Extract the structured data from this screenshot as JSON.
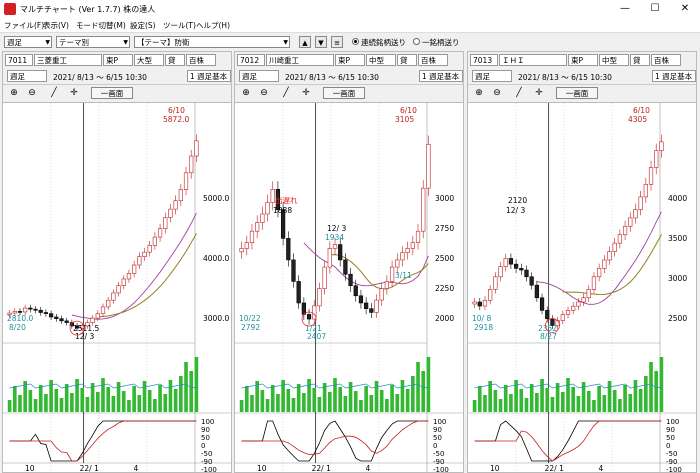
{
  "window": {
    "title": "マルチチャート (Ver 1.7.7)  株の達人",
    "minimize": "—",
    "maximize": "☐",
    "close": "✕"
  },
  "menu": [
    "ファイル(F)",
    "表示(V)",
    "モード切替(M)",
    "設定(S)",
    "ツール(T)",
    "ヘルプ(H)"
  ],
  "toolbar": {
    "period": "週足",
    "group": "テーマ別",
    "theme": "【テーマ】防衛",
    "up_icon": "▲",
    "down_icon": "▼",
    "list_icon": "≡",
    "radio1": "連続銘柄送り",
    "radio2": "一銘柄送り"
  },
  "panels": [
    {
      "code": "7011",
      "name": "三菱重工",
      "market": "東P",
      "size": "大型",
      "lending": "貸",
      "unit": "百株",
      "period": "週足",
      "date_range": "2021/ 8/13 ～  6/15 10:30",
      "basis": "1 週足基本",
      "one_screen": "一画面",
      "chart_data": {
        "type": "candlestick",
        "price_ticks": [
          "5000.0",
          "4000.0",
          "3000.0"
        ],
        "annotations": [
          {
            "text": "6/10",
            "color": "#c02020"
          },
          {
            "text": "5872.0",
            "color": "#c02020"
          },
          {
            "text": "2810.0",
            "color": "#2090a0"
          },
          {
            "text": "8/20",
            "color": "#2090a0"
          },
          {
            "text": "2511.5",
            "color": "#000"
          },
          {
            "text": "12/ 3",
            "color": "#000"
          }
        ],
        "osc_ticks": [
          "100",
          "90",
          "50",
          "0",
          "-50",
          "-90",
          "-100"
        ],
        "x_ticks": [
          "10",
          "22/ 1",
          "4"
        ],
        "close": [
          2790,
          2820,
          2810,
          2880,
          2860,
          2840,
          2800,
          2780,
          2720,
          2690,
          2650,
          2620,
          2560,
          2520,
          2560,
          2620,
          2700,
          2780,
          2900,
          3020,
          3150,
          3280,
          3400,
          3500,
          3650,
          3800,
          3880,
          4000,
          4150,
          4300,
          4500,
          4650,
          4800,
          5000,
          5300,
          5600,
          5872
        ]
      }
    },
    {
      "code": "7012",
      "name": "川崎重工",
      "market": "東P",
      "size": "中型",
      "lending": "貸",
      "unit": "百株",
      "period": "週足",
      "date_range": "2021/ 8/13 ～  6/15 10:30",
      "basis": "1 週足基本",
      "one_screen": "一画面",
      "chart_data": {
        "type": "candlestick",
        "price_ticks": [
          "3000",
          "2750",
          "2500",
          "2250",
          "2000"
        ],
        "annotations": [
          {
            "text": "6/10",
            "color": "#c02020"
          },
          {
            "text": "3105",
            "color": "#c02020"
          },
          {
            "text": "10/22",
            "color": "#2090a0"
          },
          {
            "text": "2792",
            "color": "#2090a0"
          },
          {
            "text": "1/21",
            "color": "#2090a0"
          },
          {
            "text": "2407",
            "color": "#2090a0"
          },
          {
            "text": "出遅れ",
            "color": "#e02020"
          },
          {
            "text": "1888",
            "color": "#000"
          },
          {
            "text": "12/ 3",
            "color": "#000"
          },
          {
            "text": "1934",
            "color": "#2090a0"
          },
          {
            "text": "3/11",
            "color": "#2090a0"
          }
        ],
        "osc_ticks": [
          "100",
          "90",
          "50",
          "0",
          "-50",
          "-90",
          "-100"
        ],
        "x_ticks": [
          "10",
          "22/ 1",
          "4"
        ],
        "close": [
          2380,
          2420,
          2500,
          2560,
          2620,
          2700,
          2792,
          2650,
          2450,
          2300,
          2150,
          2000,
          1920,
          1888,
          1980,
          2100,
          2250,
          2380,
          2407,
          2300,
          2200,
          2120,
          2050,
          2000,
          1960,
          1934,
          2020,
          2100,
          2150,
          2250,
          2300,
          2350,
          2380,
          2420,
          2500,
          2800,
          3105
        ]
      }
    },
    {
      "code": "7013",
      "name": "ＩＨＩ",
      "market": "東P",
      "size": "中型",
      "lending": "貸",
      "unit": "百株",
      "period": "週足",
      "date_range": "2021/ 8/13 ～  6/15 10:30",
      "basis": "1 週足基本",
      "one_screen": "一画面",
      "chart_data": {
        "type": "candlestick",
        "price_ticks": [
          "4000",
          "3500",
          "3000",
          "2500"
        ],
        "annotations": [
          {
            "text": "6/10",
            "color": "#c02020"
          },
          {
            "text": "4305",
            "color": "#c02020"
          },
          {
            "text": "10/ 8",
            "color": "#2090a0"
          },
          {
            "text": "2918",
            "color": "#2090a0"
          },
          {
            "text": "2352",
            "color": "#2090a0"
          },
          {
            "text": "8/27",
            "color": "#2090a0"
          },
          {
            "text": "2120",
            "color": "#000"
          },
          {
            "text": "12/ 3",
            "color": "#000"
          }
        ],
        "osc_ticks": [
          "100",
          "90",
          "50",
          "0",
          "-50",
          "-90",
          "-100"
        ],
        "x_ticks": [
          "10",
          "22/ 1",
          "4"
        ],
        "close": [
          2400,
          2352,
          2420,
          2550,
          2700,
          2820,
          2918,
          2850,
          2800,
          2780,
          2700,
          2600,
          2450,
          2300,
          2200,
          2120,
          2180,
          2250,
          2300,
          2350,
          2400,
          2450,
          2550,
          2700,
          2800,
          2900,
          3000,
          3100,
          3200,
          3300,
          3400,
          3500,
          3650,
          3800,
          4000,
          4200,
          4305
        ]
      }
    }
  ]
}
